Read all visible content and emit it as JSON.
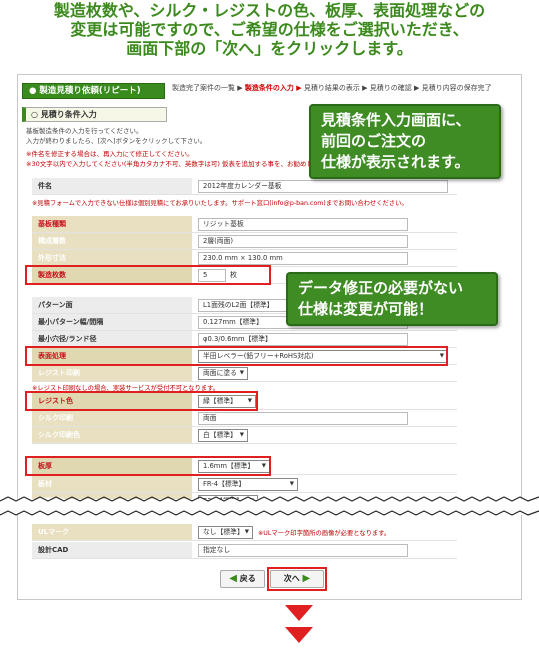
{
  "caption": {
    "line1": "製造枚数や、シルク・レジストの色、板厚、表面処理などの",
    "line2": "変更は可能ですので、ご希望の仕様をご選択いただき、",
    "line3": "画面下部の「次へ」をクリックします。"
  },
  "order_bar": {
    "label": "● 製造見積り依頼(リピート)"
  },
  "steps": {
    "items": [
      "製造完了案件の一覧 ▶",
      "製造条件の入力 ▶",
      "見積り結果の表示 ▶",
      "見積りの確認 ▶",
      "見積り内容の保存完了"
    ],
    "current_index": 1
  },
  "section_title": "○ 見積り条件入力",
  "description": {
    "line1": "基板製造条件の入力を行ってください。",
    "line2": "入力が終わりましたら、[次へ]ボタンをクリックして下さい。",
    "line3": "※件名を修正する場合は、再入力にて修正してください。",
    "line4": "※30文字以内で入力してください(半角カタカナ不可、英数字は可) 仮表を追加する事を、お勧めします。"
  },
  "form": {
    "name_label": "件名",
    "name_value": "2012年度カレンダー基板",
    "contact_note": "※見積フォームで入力できない仕様は個別見積にてお承りいたします。サポート窓口(info@p-ban.com)までお問い合わせください。",
    "board_type_label": "基板種類",
    "board_type_value": "リジット基板",
    "layers_label": "構成層数",
    "layers_value": "2層(両面)",
    "size_label": "外形寸法",
    "size_value": "230.0 mm × 130.0 mm",
    "qty_label": "製造枚数",
    "qty_value": "5",
    "qty_unit": "枚",
    "pattern_label": "パターン面",
    "pattern_value": "L1面残のL2面【標準】",
    "minpattern_label": "最小パターン幅/間隔",
    "minpattern_value": "0.127mm【標準】",
    "minhole_label": "最小穴径/ランド径",
    "minhole_value": "φ0.3/0.6mm【標準】",
    "surface_label": "表面処理",
    "surface_value": "半田レベラー(鉛フリー+RoHS対応)",
    "resist_print_label": "レジスト印刷",
    "resist_print_value": "両面に塗る",
    "resist_note": "※レジスト印刷なしの場合、実装サービスが受付不可となります。",
    "resist_color_label": "レジスト色",
    "resist_color_value": "緑【標準】",
    "silk_print_label": "シルク印刷",
    "silk_print_value": "両面",
    "silk_color_label": "シルク印刷色",
    "silk_color_value": "白【標準】",
    "thickness_label": "板厚",
    "thickness_value": "1.6mm【標準】",
    "material_label": "板材",
    "material_value": "FR-4【標準】",
    "copper_label": "銅箔厚み",
    "copper_value": "35μ【標準】",
    "ul_label": "ULマーク",
    "ul_value": "なし【標準】",
    "ul_note": "※ULマーク印字箇所の画像が必要となります。",
    "cad_label": "設計CAD",
    "cad_value": "指定なし"
  },
  "callouts": {
    "top": [
      "見積条件入力画面に、",
      "前回のご注文の",
      "仕様が表示されます。"
    ],
    "middle": [
      "データ修正の必要がない",
      "仕様は変更が可能！"
    ]
  },
  "buttons": {
    "back": "戻る",
    "next": "次へ"
  },
  "colors": {
    "accent_green": "#3a8b1e",
    "highlight_red": "#e02020",
    "caption_green": "#3c8a1e"
  }
}
